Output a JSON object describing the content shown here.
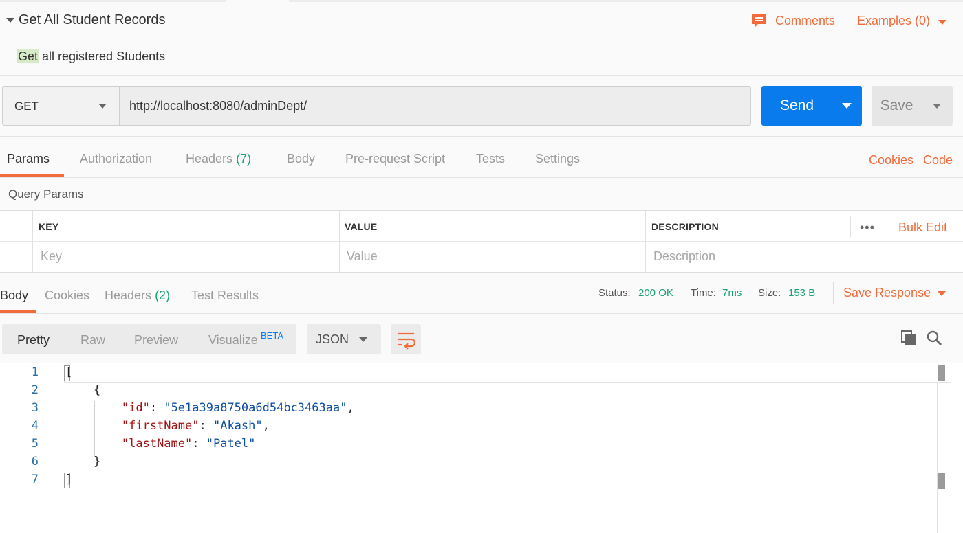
{
  "request": {
    "title": "Get All Student Records",
    "description_highlight": "Get",
    "description_rest": " all registered Students",
    "comments_label": "Comments",
    "examples_label": "Examples (0)"
  },
  "url_bar": {
    "method": "GET",
    "url": "http://localhost:8080/adminDept/",
    "send_label": "Send",
    "save_label": "Save"
  },
  "request_tabs": {
    "params": "Params",
    "authorization": "Authorization",
    "headers": "Headers",
    "headers_count": "(7)",
    "body": "Body",
    "pre_request_script": "Pre-request Script",
    "tests": "Tests",
    "settings": "Settings",
    "cookies_link": "Cookies",
    "code_link": "Code"
  },
  "query_params": {
    "title": "Query Params",
    "columns": {
      "key": "KEY",
      "value": "VALUE",
      "description": "DESCRIPTION"
    },
    "placeholders": {
      "key": "Key",
      "value": "Value",
      "description": "Description"
    },
    "more": "•••",
    "bulk_edit": "Bulk Edit"
  },
  "response_tabs": {
    "body": "Body",
    "cookies": "Cookies",
    "headers": "Headers",
    "headers_count": "(2)",
    "test_results": "Test Results"
  },
  "response_status": {
    "status_label": "Status:",
    "status_value": "200 OK",
    "time_label": "Time:",
    "time_value": "7ms",
    "size_label": "Size:",
    "size_value": "153 B",
    "save_response": "Save Response"
  },
  "view_modes": {
    "pretty": "Pretty",
    "raw": "Raw",
    "preview": "Preview",
    "visualize": "Visualize",
    "beta": "BETA",
    "format": "JSON"
  },
  "icons": {
    "comments": "comments-icon",
    "wrap": "wrap-lines-icon",
    "copy": "copy-icon",
    "search": "search-icon"
  },
  "colors": {
    "accent_orange": "#f26b3a",
    "send_blue": "#097bed",
    "status_green": "#17a275",
    "json_key": "#a31515",
    "json_string": "#0f4fa0"
  },
  "editor": {
    "line_numbers": [
      "1",
      "2",
      "3",
      "4",
      "5",
      "6",
      "7"
    ],
    "line1": "[",
    "line2": "    {",
    "id_key": "\"id\"",
    "id_value": "\"5e1a39a8750a6d54bc3463aa\"",
    "firstName_key": "\"firstName\"",
    "firstName_value": "\"Akash\"",
    "lastName_key": "\"lastName\"",
    "lastName_value": "\"Patel\"",
    "colon": ": ",
    "comma": ",",
    "line6": "    }",
    "line7": "]"
  }
}
